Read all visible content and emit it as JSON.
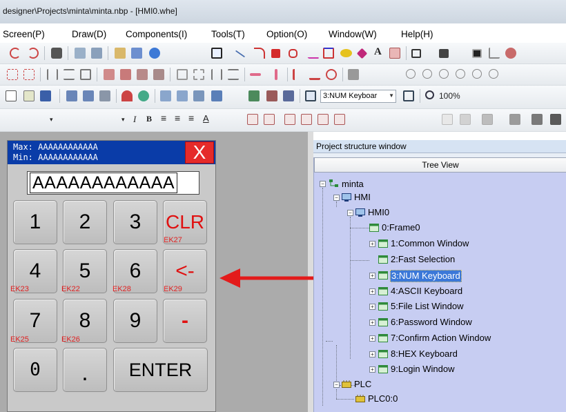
{
  "title_bar": {
    "text": "designer\\Projects\\minta\\minta.nbp - [HMI0.whe]"
  },
  "menu": [
    "Screen(P)",
    "Draw(D)",
    "Components(I)",
    "Tools(T)",
    "Option(O)",
    "Window(W)",
    "Help(H)"
  ],
  "toolbar": {
    "keyboard_combo": "3:NUM Keyboar",
    "zoom": "100%"
  },
  "keyboard": {
    "max_label": "Max: AAAAAAAAAAAA",
    "min_label": "Min: AAAAAAAAAAAA",
    "close": "X",
    "display": "AAAAAAAAAAAA",
    "keys": {
      "k1": "1",
      "k2": "2",
      "k3": "3",
      "clr": "CLR",
      "k4": "4",
      "k5": "5",
      "k6": "6",
      "back": "<-",
      "k7": "7",
      "k8": "8",
      "k9": "9",
      "minus": "-",
      "k0": "0",
      "dot": ".",
      "enter": "ENTER"
    },
    "ek_labels": {
      "ek27": "EK27",
      "ek23": "EK23",
      "ek22": "EK22",
      "ek28": "EK28",
      "ek29": "EK29",
      "ek25": "EK25",
      "ek26": "EK26"
    }
  },
  "panel": {
    "title": "Project structure window",
    "tree_view": "Tree View",
    "nodes": {
      "root": "minta",
      "hmi": "HMI",
      "hmi0": "HMI0",
      "w0": "0:Frame0",
      "w1": "1:Common Window",
      "w2": "2:Fast Selection",
      "w3": "3:NUM Keyboard",
      "w4": "4:ASCII Keyboard",
      "w5": "5:File List Window",
      "w6": "6:Password Window",
      "w7": "7:Confirm Action Window",
      "w8": "8:HEX Keyboard",
      "w9": "9:Login Window",
      "plc": "PLC",
      "plc0": "PLC0:0"
    }
  },
  "colors": {
    "keyboard_title": "#0a3ca8",
    "close_button": "#e52a2a",
    "tree_background": "#c7cdf2",
    "selection": "#3b78d8",
    "arrow": "#e31b1b"
  }
}
